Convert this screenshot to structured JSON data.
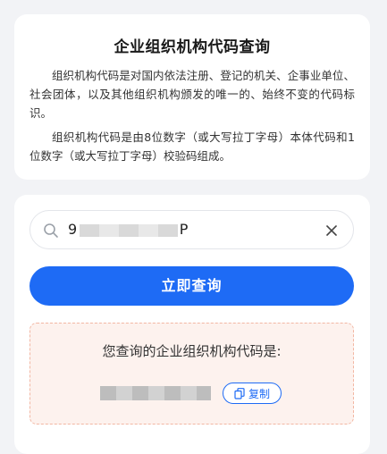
{
  "info": {
    "title": "企业组织机构代码查询",
    "para1": "组织机构代码是对国内依法注册、登记的机关、企事业单位、社会团体，以及其他组织机构颁发的唯一的、始终不变的代码标识。",
    "para2": "组织机构代码是由8位数字（或大写拉丁字母）本体代码和1位数字（或大写拉丁字母）校验码组成。"
  },
  "search": {
    "value_prefix": "9",
    "value_suffix": "P",
    "icon": "search-icon",
    "clear_icon": "close-icon",
    "button_label": "立即查询"
  },
  "result": {
    "label": "您查询的企业组织机构代码是:",
    "code_prefix": "",
    "copy_label": "复制",
    "copy_icon": "copy-icon"
  },
  "colors": {
    "accent": "#1e6bf5",
    "result_bg": "#fdf2ee",
    "result_border": "#f2b7a3",
    "page_bg": "#f2f3f6"
  }
}
